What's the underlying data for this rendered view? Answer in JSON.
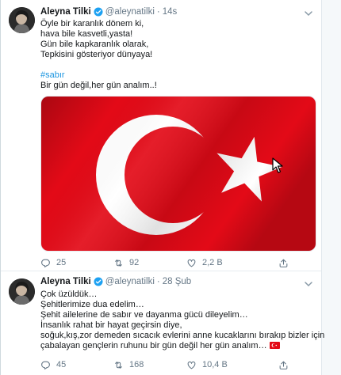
{
  "tweets": [
    {
      "author_name": "Aleyna Tilki",
      "handle": "@aleynatilki",
      "separator": "·",
      "time": "14s",
      "lines": [
        "Öyle bir karanlık dönem ki,",
        "hava bile kasvetli,yasta!",
        "Gün bile kapkaranlık olarak,",
        "Tepkisini gösteriyor dünyaya!"
      ],
      "hashtag": "#sabır",
      "closing": "Bir gün değil,her gün analım..!",
      "media_icon": "turkish-flag-image",
      "replies": "25",
      "retweets": "92",
      "likes": "2,2 B"
    },
    {
      "author_name": "Aleyna Tilki",
      "handle": "@aleynatilki",
      "separator": "·",
      "time": "28 Şub",
      "lines": [
        "Çok üzüldük…",
        "Şehitlerimize dua edelim…",
        "Şehit ailelerine de sabır ve dayanma gücü dileyelim…",
        "İnsanlık rahat bir hayat geçirsin diye,",
        "soğuk,kış,zor demeden sıcacık evlerini anne kucaklarını bırakıp bizler için",
        "çabalayan gençlerin ruhunu bir gün değil her gün analım…"
      ],
      "emoji": "turkish-flag-emoji",
      "replies": "45",
      "retweets": "168",
      "likes": "10,4 B"
    }
  ],
  "icons": [
    "avatar",
    "verified-badge-icon",
    "chevron-down-icon",
    "reply-icon",
    "retweet-icon",
    "like-icon",
    "share-icon",
    "mouse-cursor-icon"
  ],
  "colors": {
    "text": "#14171a",
    "muted": "#657786",
    "hashtag": "#1b95e0",
    "verified": "#1da1f2",
    "flag_red": "#e30a17"
  }
}
